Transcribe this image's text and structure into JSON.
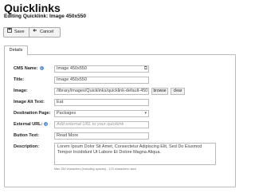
{
  "header": {
    "title": "Quicklinks",
    "subtitle": "Editing Quicklink: Image 450x550"
  },
  "toolbar": {
    "save_label": "Save",
    "cancel_label": "Cancel"
  },
  "tabs": [
    {
      "label": "Details"
    }
  ],
  "form": {
    "cms_name": {
      "label": "CMS Name:",
      "value": "Image 450x550"
    },
    "title": {
      "label": "Title:",
      "value": "Image 450x550"
    },
    "image": {
      "label": "Image:",
      "value": "/library/images/Quicklinks/quicklink-default-450",
      "browse_label": "browse",
      "clear_label": "clear"
    },
    "image_alt": {
      "label": "Image Alt Text:",
      "value": "Eat"
    },
    "destination_page": {
      "label": "Destination Page:",
      "selected": "Packages"
    },
    "external_url": {
      "label": "External URL:",
      "placeholder": "Add external URL to your quicklink"
    },
    "button_text": {
      "label": "Button Text:",
      "value": "Read More"
    },
    "description": {
      "label": "Description:",
      "value": "Lorem Ipsum Dolor Sit Amet, Consectetur Adipiscing Elit, Sed Do Eiusmod Tempor Incididunt Ut Labore Et Dolore Magna Aliqua.",
      "counter": "Max 250 characters (including spaces) - 123 characters used"
    }
  },
  "icons": {
    "save": "save-icon",
    "cancel": "back-arrow-icon",
    "help": "info-icon",
    "dropdown": "chevron-down-icon"
  }
}
